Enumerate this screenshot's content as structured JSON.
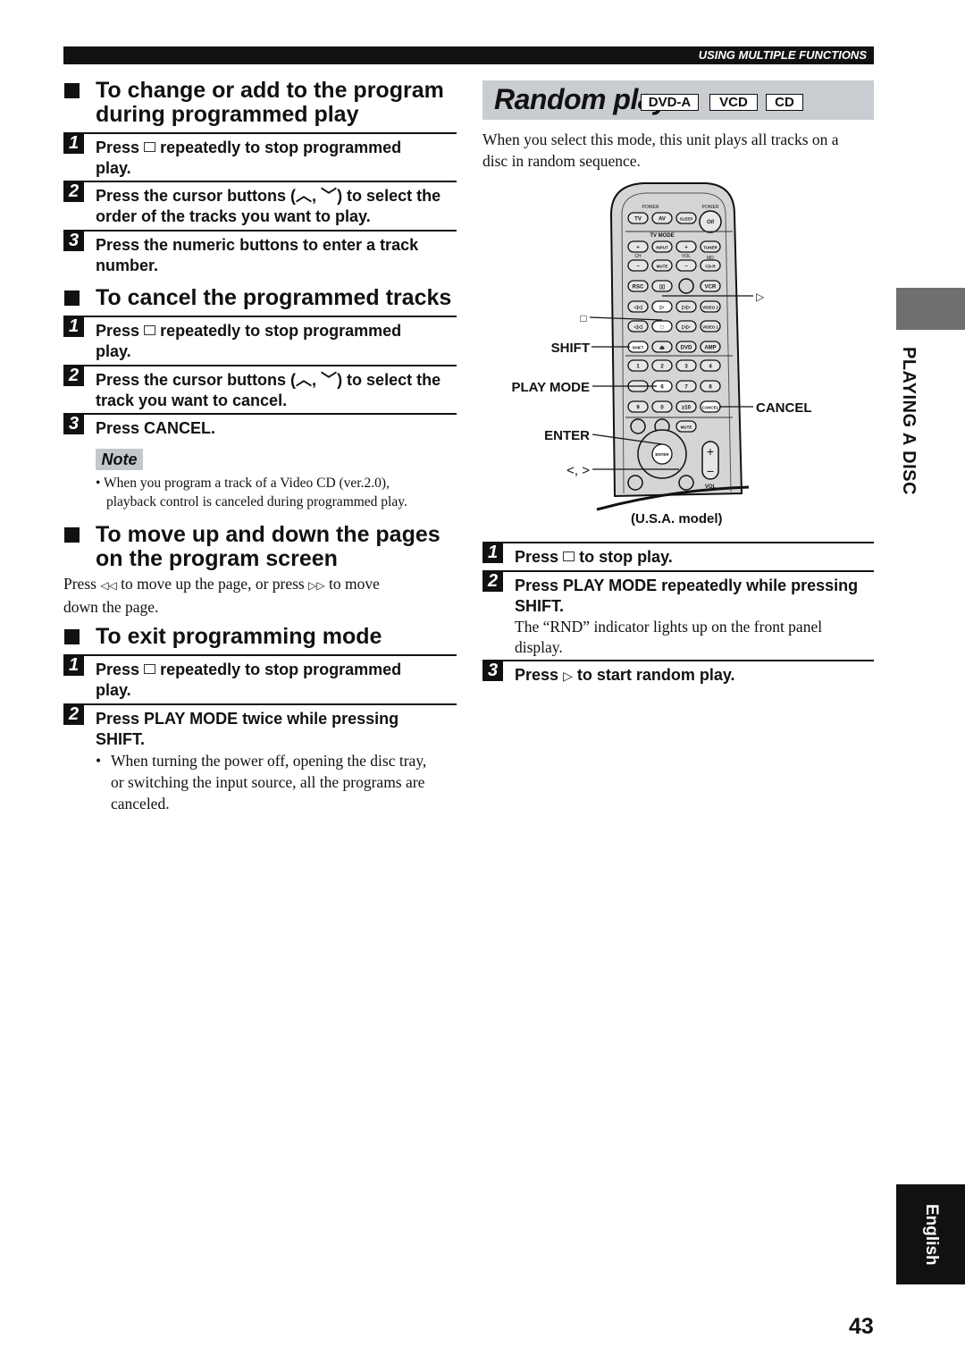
{
  "header": {
    "section": "USING MULTIPLE FUNCTIONS"
  },
  "left": {
    "change": {
      "title_1": "To change or add to the program",
      "title_2": "during programmed play",
      "steps": [
        {
          "n": "1",
          "a": "Press",
          "b": "repeatedly to stop programmed",
          "c": "play."
        },
        {
          "n": "2",
          "a": "Press the cursor buttons (",
          "b": ") to select the",
          "c": "order of the tracks you want to play."
        },
        {
          "n": "3",
          "a": "Press the numeric buttons to enter a track",
          "c": "number."
        }
      ]
    },
    "cancel": {
      "title": "To cancel the programmed tracks",
      "steps": [
        {
          "n": "1",
          "a": "Press",
          "b": "repeatedly to stop programmed",
          "c": "play."
        },
        {
          "n": "2",
          "a": "Press the cursor buttons (",
          "b": ") to select the",
          "c": "track you want to cancel."
        },
        {
          "n": "3",
          "a": "Press CANCEL."
        }
      ],
      "note_label": "Note",
      "note_1": "• When you program a track of a Video CD (ver.2.0),",
      "note_2": "playback control is canceled during programmed play."
    },
    "move": {
      "title_1": "To move up and down the pages",
      "title_2": "on the program screen",
      "text_a": "Press",
      "text_b": "to move up the page, or press",
      "text_c": "to move",
      "text_d": "down the page.",
      "prev_icon": "◁◁",
      "next_icon": "▷▷"
    },
    "exit": {
      "title": "To exit programming mode",
      "steps": [
        {
          "n": "1",
          "a": "Press",
          "b": "repeatedly to stop programmed",
          "c": "play."
        },
        {
          "n": "2",
          "a": "Press PLAY MODE twice while pressing",
          "c": "SHIFT."
        }
      ],
      "bullet": "•",
      "bullet_1": "When turning the power off, opening the disc tray,",
      "bullet_2": "or switching the input source, all the programs are",
      "bullet_3": "canceled."
    },
    "cursor_glyphs": "︿, ﹀"
  },
  "right": {
    "title": "Random play",
    "badges": [
      "DVD-A",
      "VCD",
      "CD"
    ],
    "intro_1": "When you select this mode, this unit plays all tracks on a",
    "intro_2": "disc in random sequence.",
    "callouts": {
      "play": "▷",
      "stop": "□",
      "shift": "SHIFT",
      "play_mode": "PLAY MODE",
      "cancel": "CANCEL",
      "enter": "ENTER",
      "cursor": "<, >"
    },
    "caption": "(U.S.A. model)",
    "steps": [
      {
        "n": "1",
        "a": "Press",
        "b": "to stop play."
      },
      {
        "n": "2",
        "a": "Press PLAY MODE repeatedly while pressing",
        "c": "SHIFT.",
        "d": "The “RND” indicator lights up on the front panel",
        "e": "display."
      },
      {
        "n": "3",
        "a": "Press",
        "icon": "▷",
        "b": "to start random play."
      }
    ]
  },
  "remote": {
    "labels": {
      "power": "POWER",
      "power2": "POWER",
      "tvmode": "TV MODE",
      "ch": "CH",
      "vol": "VOL",
      "md": "MD",
      "vol2": "VOL",
      "enter": "ENTER"
    },
    "rows": [
      [
        "TV",
        "AV",
        "SLEEP",
        "⏻/I"
      ],
      [
        "+",
        "INPUT",
        "+",
        "TUNER"
      ],
      [
        "−",
        "MUTE",
        "−",
        "CD-R"
      ],
      [
        "RSC",
        "▯▯",
        "",
        "VCR"
      ],
      [
        "◁◁",
        "▷",
        "▷▷",
        "VIDEO 2"
      ],
      [
        "◁◁",
        "□",
        "▷▷",
        "VIDEO 1"
      ],
      [
        "SHIFT",
        "⏏",
        "DVD",
        "AMP"
      ],
      [
        "1",
        "2",
        "3",
        "4"
      ],
      [
        "",
        "6",
        "7",
        "8"
      ],
      [
        "9",
        "0",
        "≥10",
        "CANCEL"
      ],
      [
        "",
        "",
        "MUTE",
        ""
      ]
    ]
  },
  "side": {
    "tab": "PLAYING A DISC",
    "language": "English"
  },
  "page_number": "43"
}
